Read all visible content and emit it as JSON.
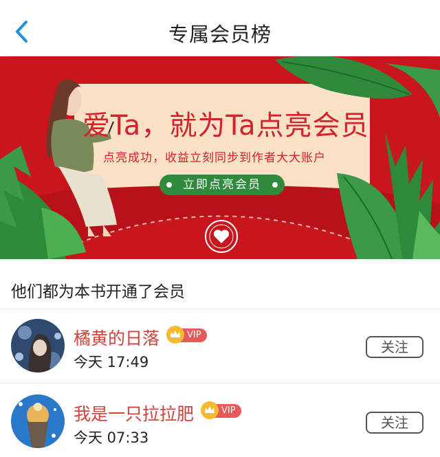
{
  "header": {
    "title": "专属会员榜",
    "back_icon": "chevron-left-icon"
  },
  "banner": {
    "headline": "爱Ta，就为Ta点亮会员",
    "subtitle": "点亮成功，收益立刻同步到作者大大账户",
    "cta_label": "立即点亮会员",
    "colors": {
      "background": "#c8161d",
      "card": "#fbe1c6",
      "text": "#d6202a",
      "cta": "#2f8a3c"
    }
  },
  "section": {
    "title": "他们都为本书开通了会员"
  },
  "members": [
    {
      "name": "橘黄的日落",
      "badge": "VIP",
      "time": "今天 17:49",
      "follow_label": "关注"
    },
    {
      "name": "我是一只拉拉肥",
      "badge": "VIP",
      "time": "今天 07:33",
      "follow_label": "关注"
    }
  ],
  "colors": {
    "accent": "#1e90e8",
    "name": "#d0423c",
    "vip": "#e85858",
    "crown": "#f5b932"
  }
}
